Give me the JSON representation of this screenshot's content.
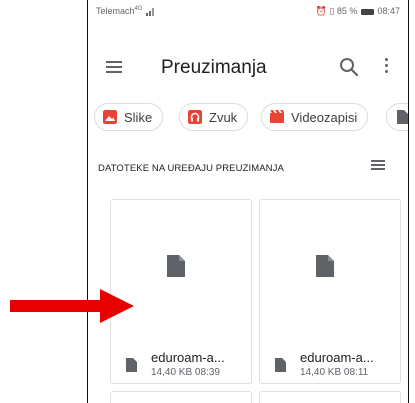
{
  "status_bar": {
    "carrier": "Telemach",
    "network": "4G",
    "battery": "85 %",
    "time": "08:47"
  },
  "app_bar": {
    "title": "Preuzimanja"
  },
  "chips": [
    {
      "label": "Slike",
      "icon": "image-icon",
      "color": "#ea4335"
    },
    {
      "label": "Zvuk",
      "icon": "audio-icon",
      "color": "#ea4335"
    },
    {
      "label": "Videozapisi",
      "icon": "video-icon",
      "color": "#ea4335"
    }
  ],
  "section_header": "DATOTEKE NA UREĐAJU PREUZIMANJA",
  "files": [
    {
      "name": "eduroam-a...",
      "meta": "14,40 KB 08:39",
      "icon": "file-icon"
    },
    {
      "name": "eduroam-a...",
      "meta": "14,40 KB 08:11",
      "icon": "file-icon"
    }
  ],
  "annotation": {
    "color": "#e60000"
  }
}
